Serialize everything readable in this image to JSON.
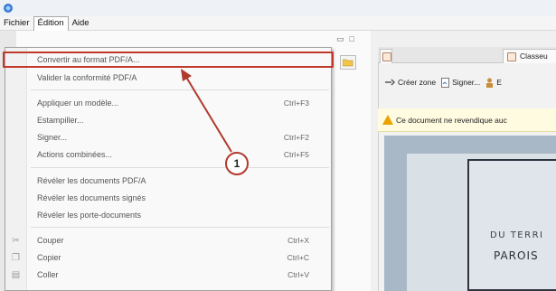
{
  "menubar": {
    "items": [
      "Fichier",
      "Édition",
      "Aide"
    ]
  },
  "edit_menu": {
    "items": [
      {
        "label": "Convertir au format PDF/A...",
        "shortcut": ""
      },
      {
        "label": "Valider la conformité PDF/A",
        "shortcut": ""
      },
      {
        "label": "Appliquer un modèle...",
        "shortcut": "Ctrl+F3"
      },
      {
        "label": "Estampiller...",
        "shortcut": ""
      },
      {
        "label": "Signer...",
        "shortcut": "Ctrl+F2"
      },
      {
        "label": "Actions combinées...",
        "shortcut": "Ctrl+F5"
      },
      {
        "label": "Révéler les documents PDF/A",
        "shortcut": ""
      },
      {
        "label": "Révéler les documents signés",
        "shortcut": ""
      },
      {
        "label": "Révéler les porte-documents",
        "shortcut": ""
      },
      {
        "label": "Couper",
        "shortcut": "Ctrl+X"
      },
      {
        "label": "Copier",
        "shortcut": "Ctrl+C"
      },
      {
        "label": "Coller",
        "shortcut": "Ctrl+V"
      }
    ]
  },
  "callout": {
    "number": "1"
  },
  "right_panel": {
    "tab_label": "Classeu",
    "toolbar": {
      "create_zone": "Créer zone",
      "sign": "Signer...",
      "third": "E"
    },
    "notice": "Ce document ne revendique auc",
    "document": {
      "line1": "DU TERRI",
      "line2": "PAROIS"
    }
  },
  "colors": {
    "highlight": "#c0392b",
    "warning": "#e9a300"
  }
}
